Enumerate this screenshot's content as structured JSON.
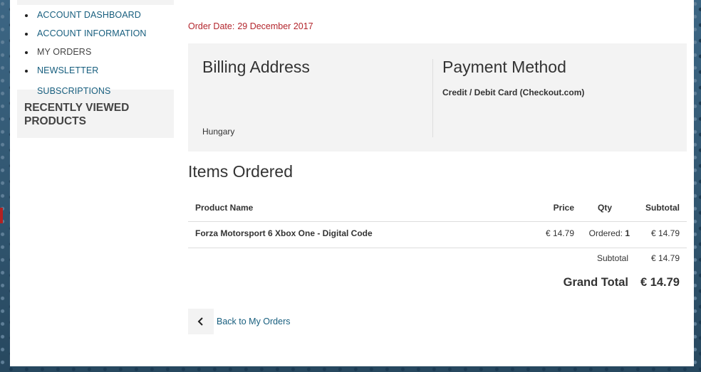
{
  "sidebar": {
    "nav": [
      {
        "label": "ACCOUNT DASHBOARD",
        "active": false
      },
      {
        "label": "ACCOUNT INFORMATION",
        "active": false
      },
      {
        "label": "MY ORDERS",
        "active": true
      },
      {
        "label": "NEWSLETTER SUBSCRIPTIONS",
        "active": false
      }
    ],
    "recently_viewed_title": "RECENTLY VIEWED PRODUCTS"
  },
  "order": {
    "date_label": "Order Date:",
    "date_value": "29 December 2017"
  },
  "billing": {
    "title": "Billing Address",
    "country": "Hungary"
  },
  "payment": {
    "title": "Payment Method",
    "method": "Credit / Debit Card (Checkout.com)"
  },
  "items": {
    "title": "Items Ordered",
    "headers": {
      "name": "Product Name",
      "price": "Price",
      "qty": "Qty",
      "subtotal": "Subtotal"
    },
    "rows": [
      {
        "name": "Forza Motorsport 6 Xbox One - Digital Code",
        "price": "€ 14.79",
        "qty_label": "Ordered:",
        "qty_value": "1",
        "subtotal": "€ 14.79"
      }
    ]
  },
  "totals": {
    "subtotal_label": "Subtotal",
    "subtotal_value": "€ 14.79",
    "grand_label": "Grand Total",
    "grand_value": "€ 14.79"
  },
  "back": {
    "label": "Back to My Orders",
    "icon": "chevron-left-icon"
  },
  "colors": {
    "link": "#175e7e",
    "accent_red": "#b3262d",
    "box_bg": "#f3f3f3"
  }
}
